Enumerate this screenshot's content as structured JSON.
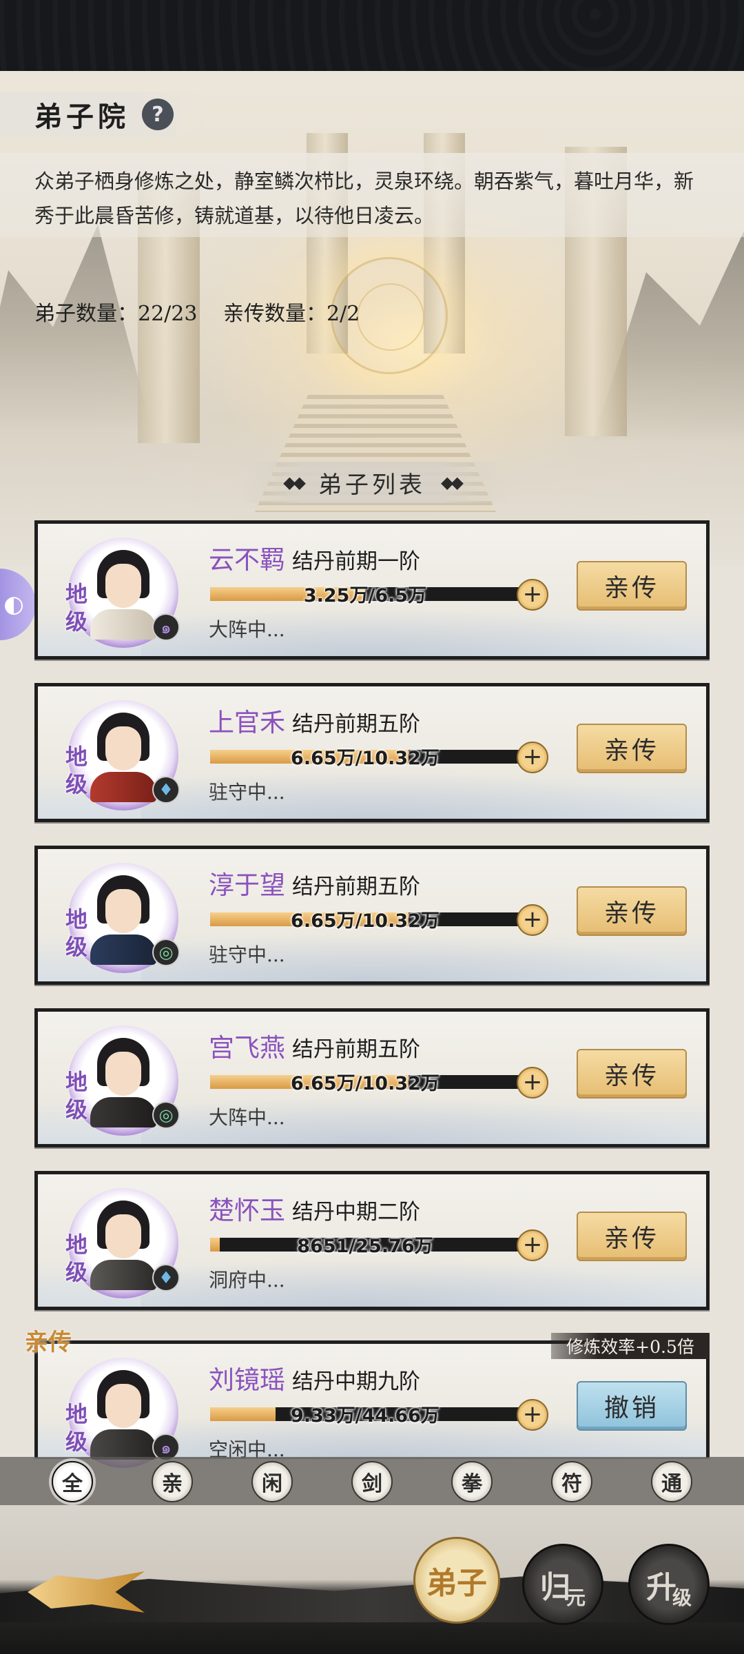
{
  "header": {
    "title": "弟子院",
    "help_icon": "?",
    "description": "众弟子栖身修炼之处，静室鳞次栉比，灵泉环绕。朝吞紫气，暮吐月华，新秀于此晨昏苦修，铸就道基，以待他日凌云。",
    "disciple_count": "弟子数量：22/23",
    "personal_count": "亲传数量：2/2"
  },
  "list_title": "弟子列表",
  "side_button_icon": "gamepad-icon",
  "disciples": [
    {
      "rank": "地级",
      "name": "云不羁",
      "realm": "结丹前期一阶",
      "progress_text": "3.25万/6.5万",
      "progress": 0.5,
      "status": "大阵中...",
      "element": "flame",
      "action": "亲传"
    },
    {
      "rank": "地级",
      "name": "上官禾",
      "realm": "结丹前期五阶",
      "progress_text": "6.65万/10.32万",
      "progress": 0.64,
      "status": "驻守中...",
      "element": "water",
      "action": "亲传"
    },
    {
      "rank": "地级",
      "name": "淳于望",
      "realm": "结丹前期五阶",
      "progress_text": "6.65万/10.32万",
      "progress": 0.64,
      "status": "驻守中...",
      "element": "wind",
      "action": "亲传"
    },
    {
      "rank": "地级",
      "name": "宫飞燕",
      "realm": "结丹前期五阶",
      "progress_text": "6.65万/10.32万",
      "progress": 0.64,
      "status": "大阵中...",
      "element": "wind",
      "action": "亲传"
    },
    {
      "rank": "地级",
      "name": "楚怀玉",
      "realm": "结丹中期二阶",
      "progress_text": "8651/25.76万",
      "progress": 0.03,
      "status": "洞府中...",
      "element": "water",
      "action": "亲传"
    },
    {
      "rank": "地级",
      "name": "刘镜瑶",
      "realm": "结丹中期九阶",
      "progress_text": "9.33万/44.66万",
      "progress": 0.21,
      "status": "空闲中...",
      "element": "flame",
      "action": "撤销",
      "tag": "亲传",
      "bonus": "修炼效率+0.5倍"
    }
  ],
  "filters": [
    "全",
    "亲",
    "闲",
    "剑",
    "拳",
    "符",
    "通"
  ],
  "nav": {
    "dizi": "弟子",
    "guiyuan_main": "归",
    "guiyuan_sub": "元",
    "shengji_main": "升",
    "shengji_sub": "级"
  },
  "colors": {
    "rank_purple": "#7e4fb6",
    "name_purple": "#8a52be",
    "gold_button": "#e6bd72",
    "blue_button": "#8ec2dc"
  }
}
